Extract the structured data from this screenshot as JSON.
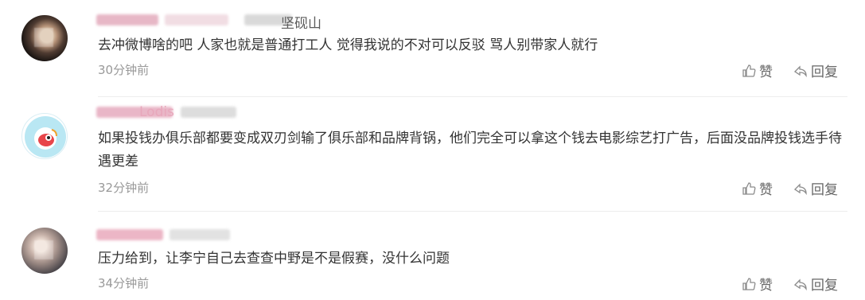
{
  "comments": [
    {
      "username_visible": "坚砚山",
      "content": "去冲微博啥的吧 人家也就是普通打工人 觉得我说的不对可以反驳 骂人别带家人就行",
      "time": "30分钟前",
      "like_label": "赞",
      "reply_label": "回复"
    },
    {
      "username_visible": "Lodis",
      "content": "如果投钱办俱乐部都要变成双刃剑输了俱乐部和品牌背锅，他们完全可以拿这个钱去电影综艺打广告，后面没品牌投钱选手待遇更差",
      "time": "32分钟前",
      "like_label": "赞",
      "reply_label": "回复"
    },
    {
      "username_visible": "",
      "content": "压力给到，让李宁自己去查查中野是不是假赛，没什么问题",
      "time": "34分钟前",
      "like_label": "赞",
      "reply_label": "回复"
    }
  ],
  "colors": {
    "accent_pink": "#f2a6bc",
    "text": "#333333",
    "time_gray": "#999999"
  }
}
